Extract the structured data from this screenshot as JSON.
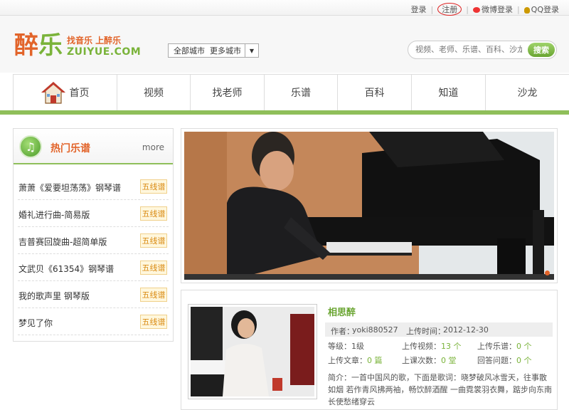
{
  "topbar": {
    "login": "登录",
    "register": "注册",
    "weibo_login": "微博登录",
    "qq_login": "QQ登录"
  },
  "logo": {
    "char1": "醉",
    "char2": "乐",
    "slogan_cn": "找音乐 上醉乐",
    "slogan_en": "ZUIYUE.COM"
  },
  "city": {
    "all": "全部城市",
    "more": "更多城市"
  },
  "search": {
    "placeholder": "视频、老师、乐谱、百科、沙龙",
    "button": "搜索"
  },
  "nav": {
    "items": [
      "首页",
      "视频",
      "找老师",
      "乐谱",
      "百科",
      "知道",
      "沙龙"
    ]
  },
  "sidebar": {
    "title": "热门乐谱",
    "more": "more",
    "items": [
      {
        "name": "萧萧《爱要坦荡荡》钢琴谱",
        "tag": "五线谱"
      },
      {
        "name": "婚礼进行曲-简易版",
        "tag": "五线谱"
      },
      {
        "name": "吉普赛回旋曲-超简单版",
        "tag": "五线谱"
      },
      {
        "name": "文武贝《61354》钢琴谱",
        "tag": "五线谱"
      },
      {
        "name": "我的歌声里 钢琴版",
        "tag": "五线谱"
      },
      {
        "name": "梦见了你",
        "tag": "五线谱"
      }
    ]
  },
  "card": {
    "title": "相思醉",
    "author_label": "作者：",
    "author": "yoki880527",
    "upload_time_label": "上传时间：",
    "upload_time": "2012-12-30",
    "level_label": "等级：",
    "level": "1级",
    "videos_label": "上传视频：",
    "videos": "13 个",
    "scores_label": "上传乐谱：",
    "scores": "0 个",
    "articles_label": "上传文章：",
    "articles": "0 篇",
    "lessons_label": "上课次数：",
    "lessons": "0 堂",
    "answers_label": "回答问题：",
    "answers": "0 个",
    "intro_label": "简介：",
    "intro": "一首中国风的歌，下面是歌词：晓梦破风冰雪天，往事散如烟 若作青风拂两袖，畅饮醉酒醒 一曲霓裳羽衣舞，踮步向东南 长使愁绪穿云"
  },
  "colors": {
    "orange": "#e2642a",
    "green": "#7ab33a",
    "nav_line": "#8fbf5a"
  }
}
